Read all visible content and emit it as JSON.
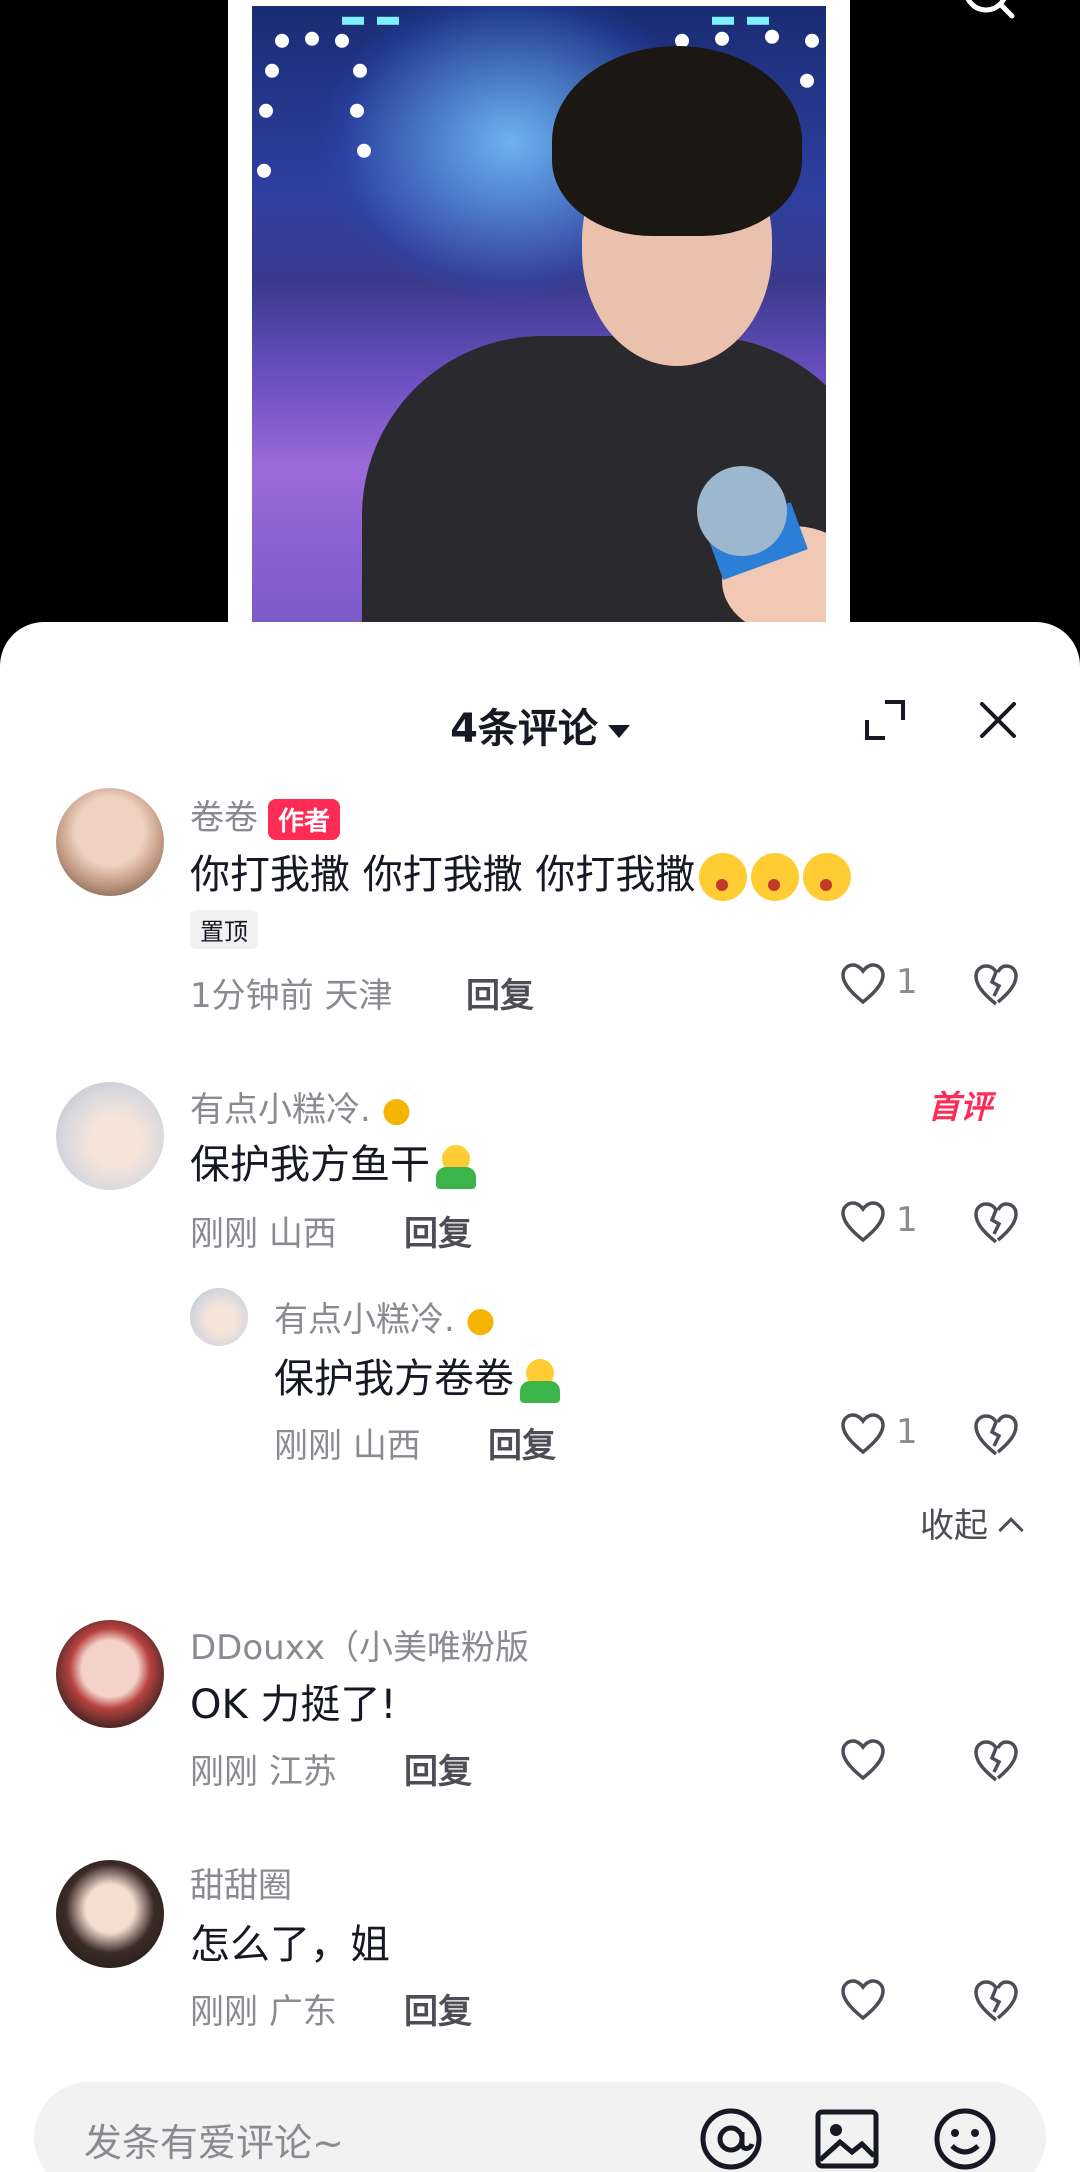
{
  "sheet": {
    "title": "4条评论"
  },
  "comments": [
    {
      "username": "卷卷",
      "badge": "作者",
      "content": "你打我撒 你打我撒 你打我撒",
      "pin_label": "置顶",
      "time": "1分钟前",
      "location": "天津",
      "reply_label": "回复",
      "likes": "1"
    },
    {
      "username": "有点小糕冷.",
      "first_badge": "首评",
      "content": "保护我方鱼干",
      "time": "刚刚",
      "location": "山西",
      "reply_label": "回复",
      "likes": "1",
      "replies": [
        {
          "username": "有点小糕冷.",
          "content": "保护我方卷卷",
          "time": "刚刚",
          "location": "山西",
          "reply_label": "回复",
          "likes": "1"
        }
      ]
    },
    {
      "username": "DDouxx（小美唯粉版",
      "content": "OK 力挺了!",
      "time": "刚刚",
      "location": "江苏",
      "reply_label": "回复"
    },
    {
      "username": "甜甜圈",
      "content": "怎么了，姐",
      "time": "刚刚",
      "location": "广东",
      "reply_label": "回复"
    }
  ],
  "collapse_label": "收起",
  "input": {
    "placeholder": "发条有爱评论~"
  },
  "colors": {
    "accent": "#fe2c55",
    "text_primary": "#161823",
    "text_secondary": "#8a8b91"
  },
  "icons": [
    "search-icon",
    "expand-icon",
    "close-icon",
    "like-icon",
    "dislike-icon",
    "at-icon",
    "image-icon",
    "emoji-icon"
  ]
}
